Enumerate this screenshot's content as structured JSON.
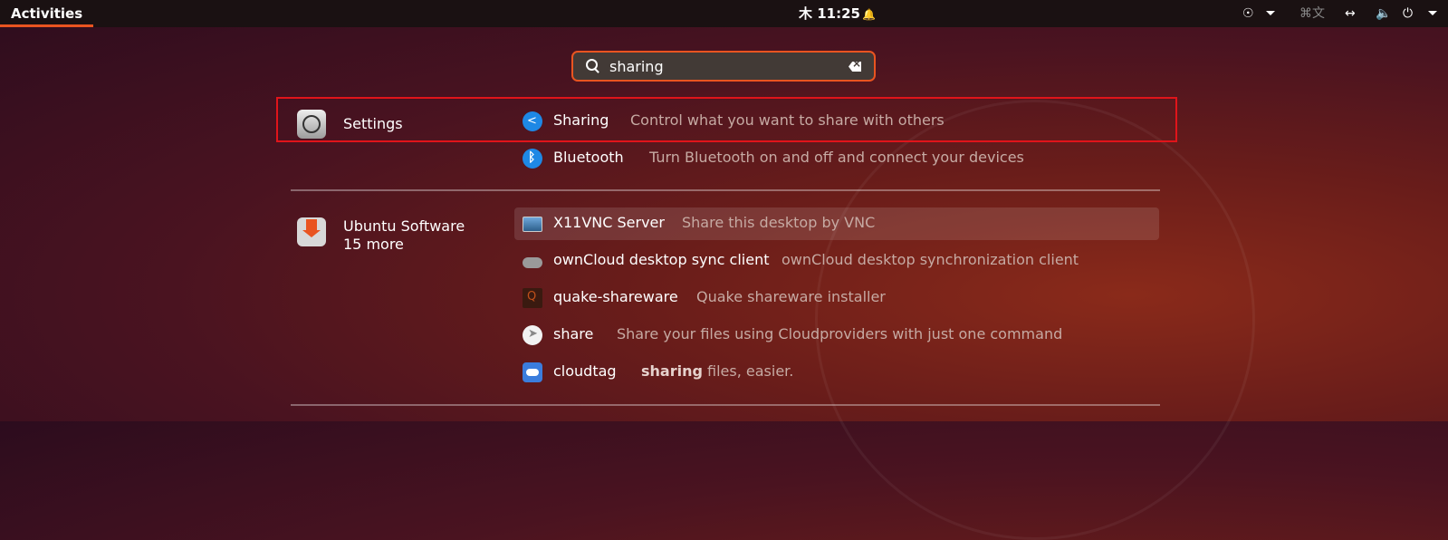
{
  "topbar": {
    "activities": "Activities",
    "clock": "木 11:25",
    "tray_icons": [
      "accessibility-icon",
      "keyboard-icon",
      "network-icon",
      "volume-icon",
      "power-icon"
    ],
    "input_method": "⌘文"
  },
  "search": {
    "value": "sharing"
  },
  "providers": [
    {
      "name": "Settings",
      "results": [
        {
          "title": "Sharing",
          "description": "Control what you want to share with others"
        },
        {
          "title": "Bluetooth",
          "description": "Turn Bluetooth on and off and connect your devices"
        }
      ]
    },
    {
      "name": "Ubuntu Software",
      "more": "15 more",
      "results": [
        {
          "title": "X11VNC Server",
          "description": "Share this desktop by VNC"
        },
        {
          "title": "ownCloud desktop sync client",
          "description": "ownCloud desktop synchronization client"
        },
        {
          "title": "quake-shareware",
          "description": "Quake shareware installer"
        },
        {
          "title": "share",
          "description": "Share your files using Cloudproviders with just one command"
        },
        {
          "title": "cloudtag",
          "description_bold": "sharing",
          "description_rest": " files, easier."
        }
      ]
    }
  ],
  "colors": {
    "accent": "#e95420",
    "highlight_box": "#e0141a"
  }
}
